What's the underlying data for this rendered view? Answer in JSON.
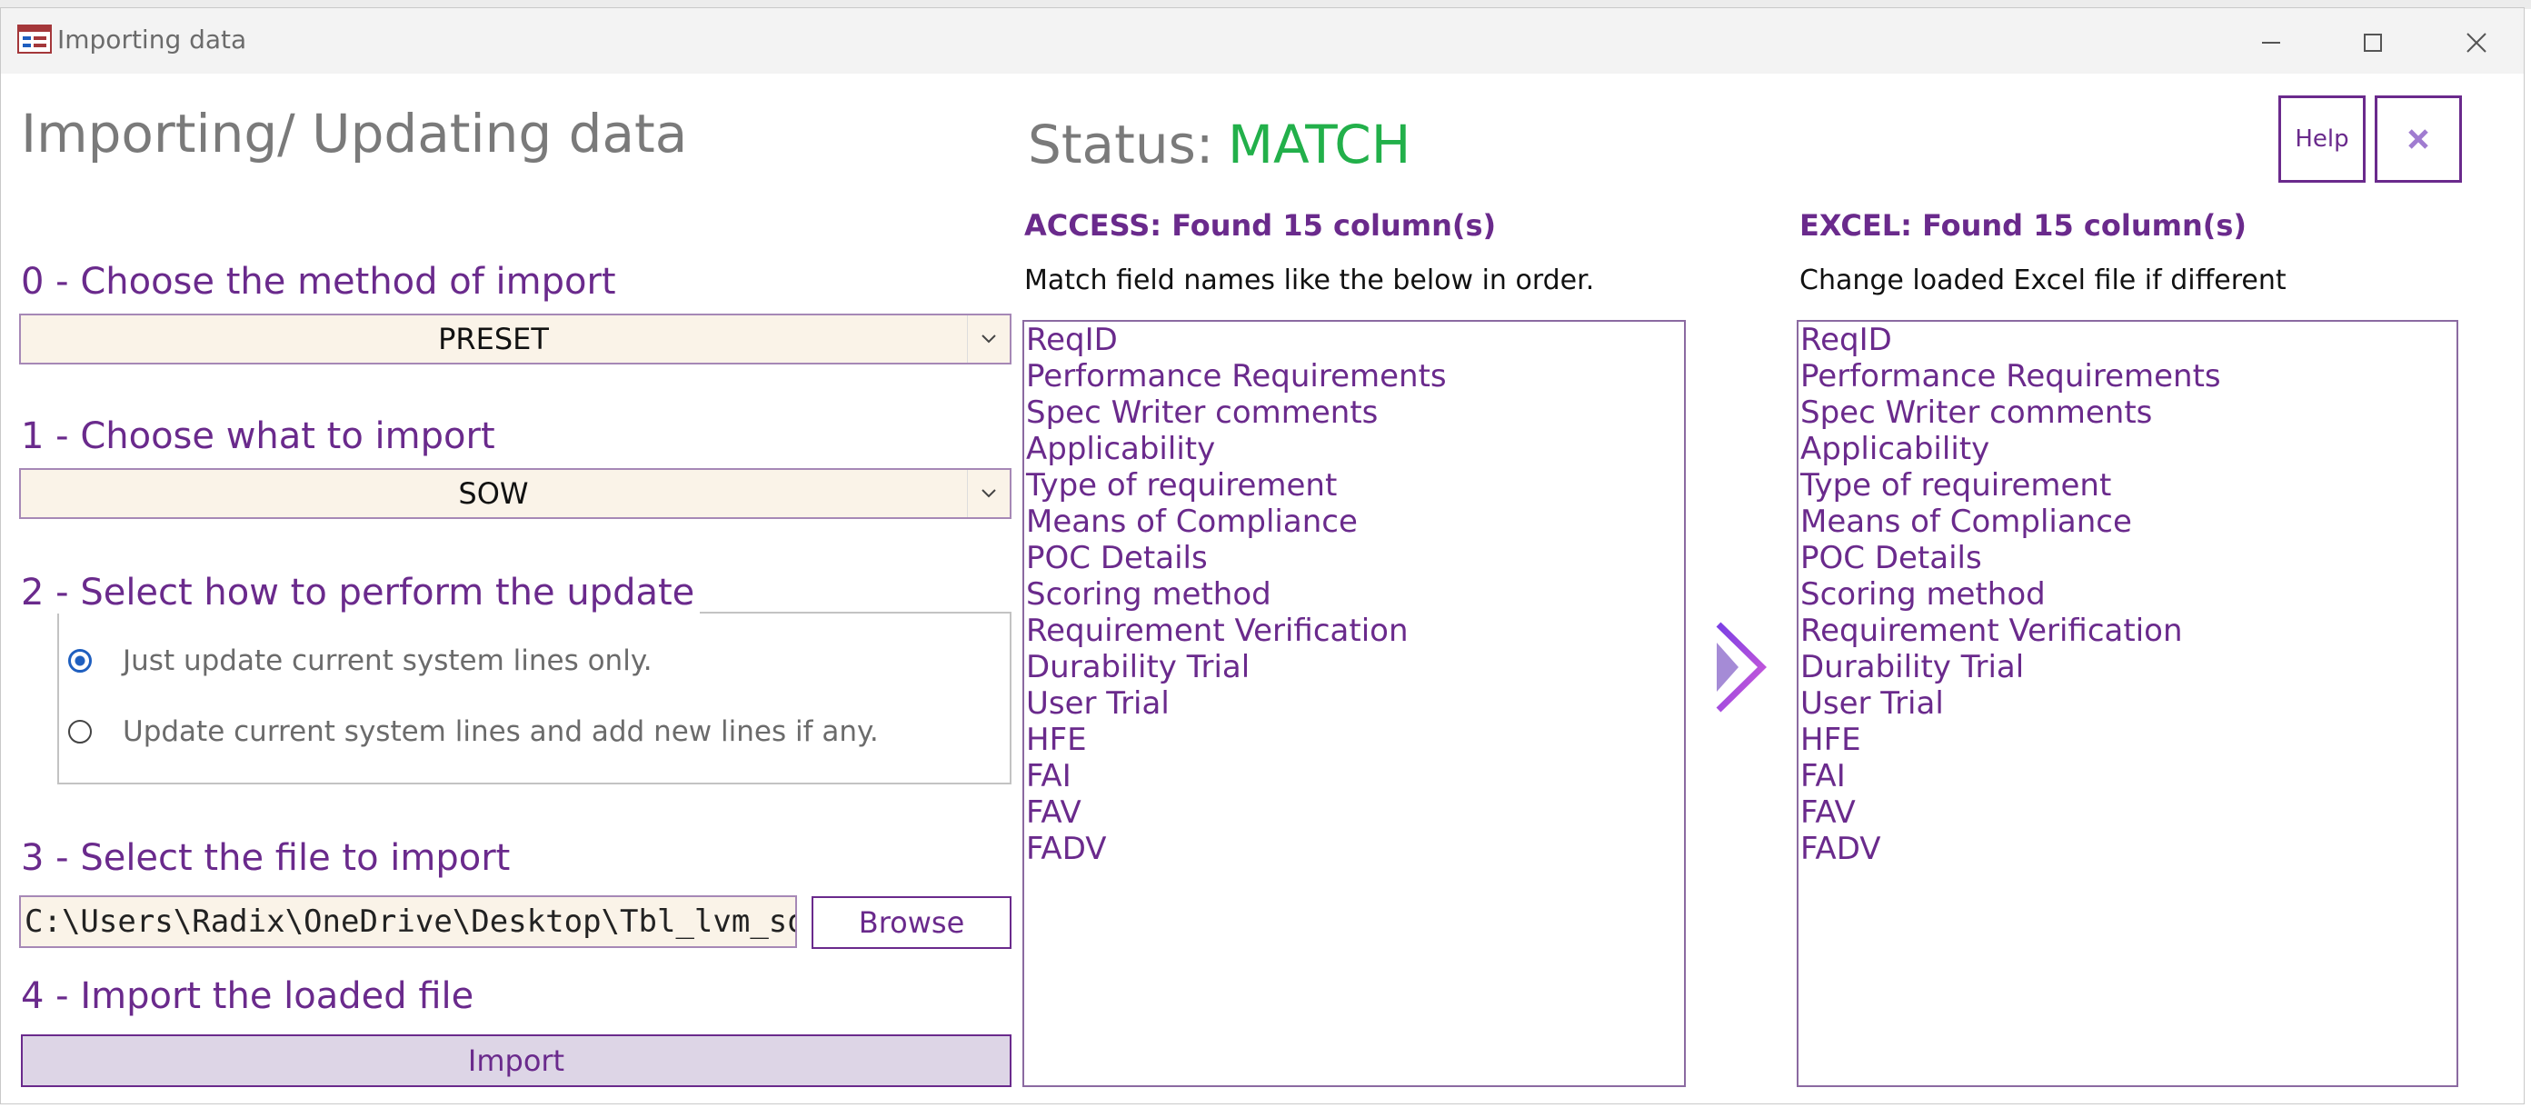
{
  "window": {
    "title": "Importing data",
    "icon": "form-icon"
  },
  "heading": "Importing/ Updating data",
  "status": {
    "label": "Status:",
    "value": "MATCH",
    "color": "#22b04a"
  },
  "buttons": {
    "help": "Help",
    "close_icon": "close-icon",
    "browse": "Browse",
    "import": "Import"
  },
  "step0": {
    "label": "0 - Choose the method of import",
    "value": "PRESET"
  },
  "step1": {
    "label": "1 - Choose what to import",
    "value": "SOW"
  },
  "step2": {
    "label": "2 - Select how to perform the update",
    "options": [
      {
        "label": "Just update current system lines only.",
        "selected": true
      },
      {
        "label": "Update current system lines and add new lines if any.",
        "selected": false
      }
    ]
  },
  "step3": {
    "label": "3 - Select the file to import",
    "file_path": "C:\\Users\\Radix\\OneDrive\\Desktop\\Tbl_lvm_sow_a"
  },
  "step4": {
    "label": "4 - Import the loaded file"
  },
  "access": {
    "header": "ACCESS: Found 15 column(s)",
    "subtitle": "Match field names like the below in order.",
    "fields": [
      "ReqID",
      "Performance Requirements",
      "Spec Writer comments",
      "Applicability",
      "Type of requirement",
      "Means of Compliance",
      "POC Details",
      "Scoring method",
      "Requirement Verification",
      "Durability Trial",
      "User Trial",
      "HFE",
      "FAI",
      "FAV",
      "FADV"
    ]
  },
  "excel": {
    "header": "EXCEL: Found 15 column(s)",
    "subtitle": "Change loaded Excel file if different",
    "fields": [
      "ReqID",
      "Performance Requirements",
      "Spec Writer comments",
      "Applicability",
      "Type of requirement",
      "Means of Compliance",
      "POC Details",
      "Scoring method",
      "Requirement Verification",
      "Durability Trial",
      "User Trial",
      "HFE",
      "FAI",
      "FAV",
      "FADV"
    ]
  },
  "theme": {
    "accent": "#6a2a8c",
    "input_bg": "#faf3e8",
    "import_bg": "#ddd5e6"
  }
}
